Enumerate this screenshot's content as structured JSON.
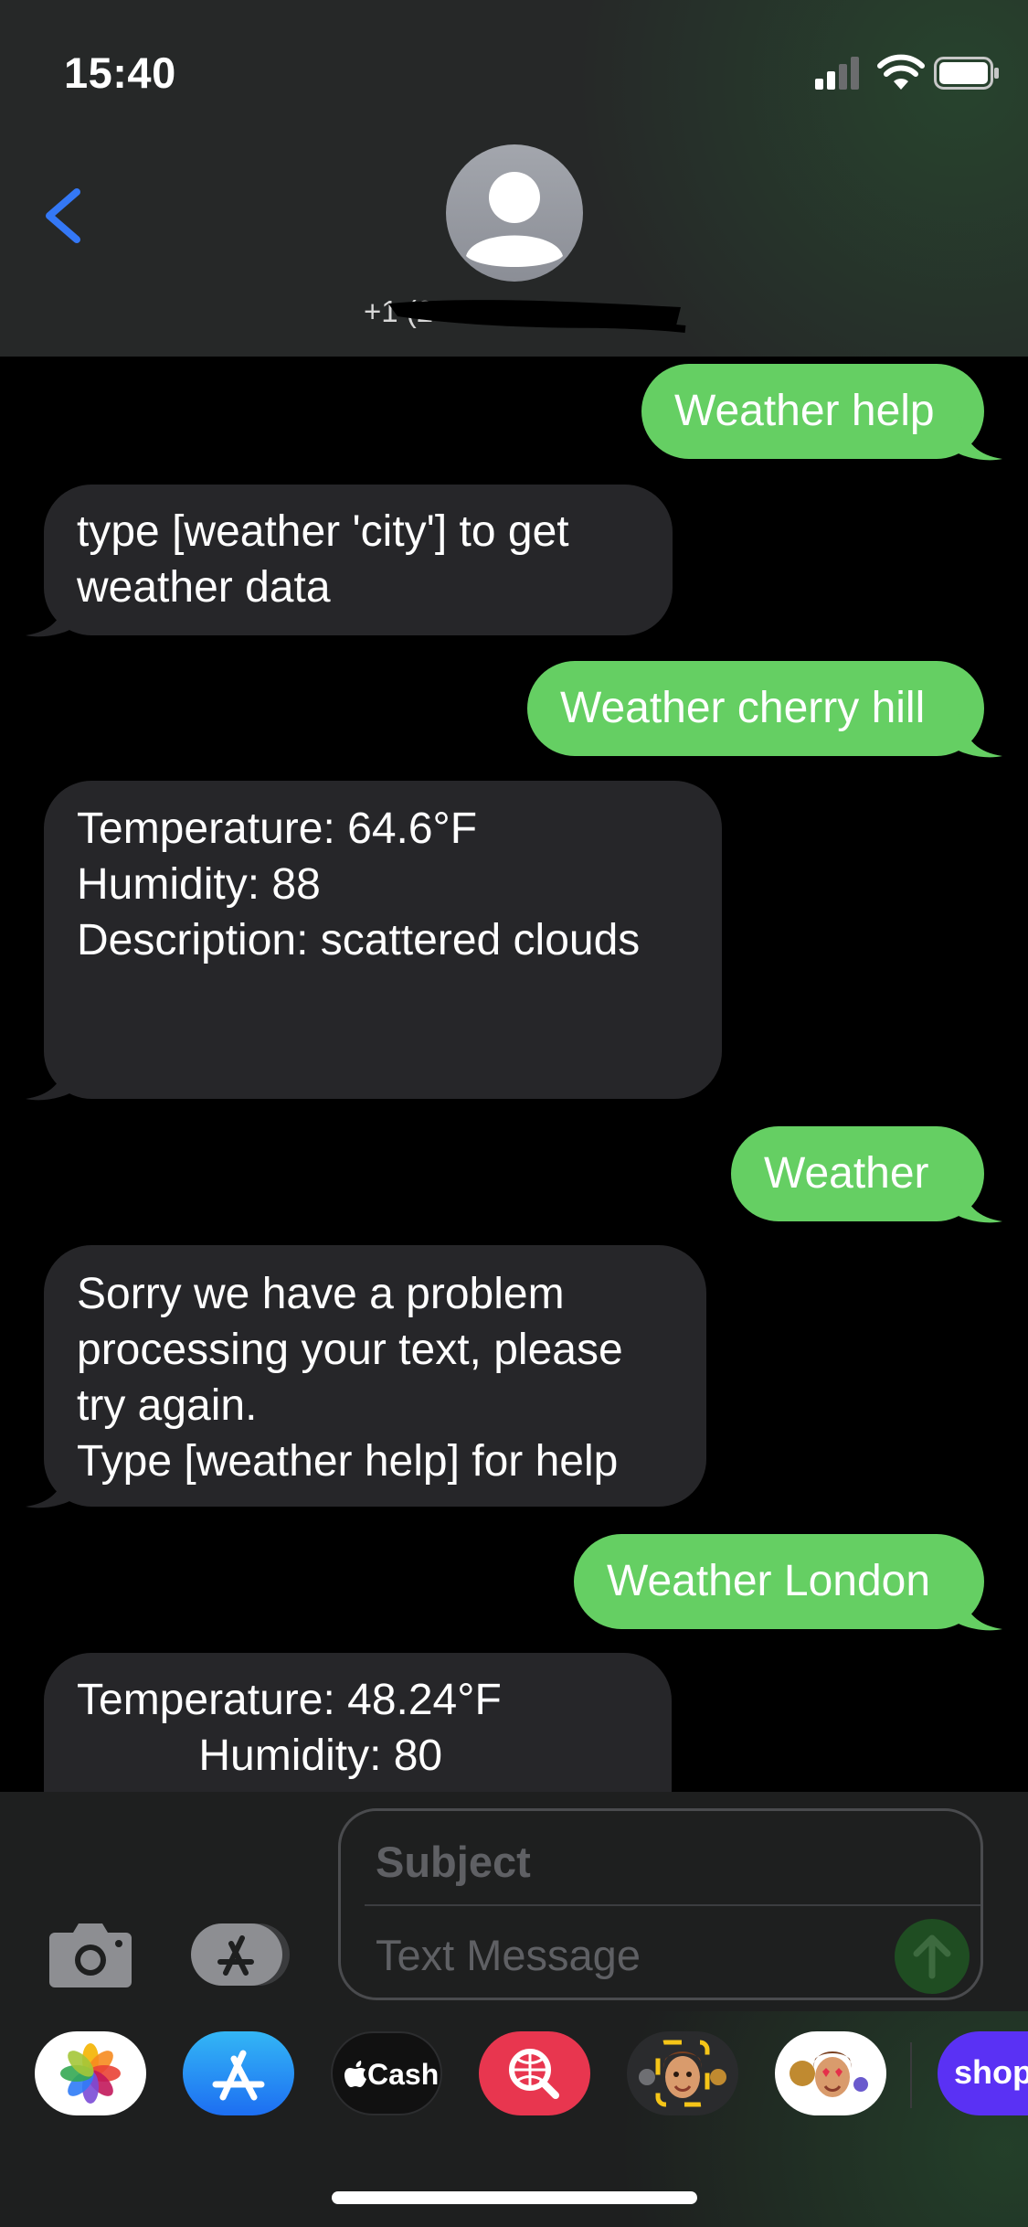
{
  "status_bar": {
    "time": "15:40"
  },
  "header": {
    "contact_number": "+1 (2"
  },
  "messages": [
    {
      "direction": "sent",
      "lines": [
        "Weather help"
      ]
    },
    {
      "direction": "received",
      "lines": [
        "type [weather 'city'] to get",
        "weather data"
      ]
    },
    {
      "direction": "sent",
      "lines": [
        "Weather cherry hill"
      ]
    },
    {
      "direction": "received",
      "lines": [
        "Temperature: 64.6°F",
        "",
        "Humidity: 88",
        "",
        "Description: scattered clouds"
      ]
    },
    {
      "direction": "sent",
      "lines": [
        "Weather"
      ]
    },
    {
      "direction": "received",
      "lines": [
        "Sorry we have a problem",
        "processing your text, please",
        "try again.",
        "Type [weather help] for help"
      ]
    },
    {
      "direction": "sent",
      "lines": [
        "Weather London"
      ]
    },
    {
      "direction": "received",
      "lines": [
        "Temperature: 48.24°F",
        "          Humidity: 80"
      ]
    }
  ],
  "compose": {
    "subject_placeholder": "Subject",
    "text_placeholder": "Text Message"
  },
  "app_drawer": {
    "items": [
      {
        "name": "photos-app",
        "label": ""
      },
      {
        "name": "app-store-app",
        "label": ""
      },
      {
        "name": "cash-app",
        "label": "Cash"
      },
      {
        "name": "search-images-app",
        "label": ""
      },
      {
        "name": "memoji-app",
        "label": ""
      },
      {
        "name": "memoji-stickers-app",
        "label": ""
      },
      {
        "name": "shop-app",
        "label": "shop"
      }
    ]
  },
  "colors": {
    "sent_bubble": "#65cf63",
    "received_bubble": "#262629",
    "accent_blue": "#3478f6"
  }
}
